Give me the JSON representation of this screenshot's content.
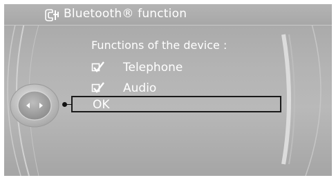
{
  "window": {
    "title": "Bluetooth® function",
    "title_icon": "phone-settings-icon"
  },
  "section": {
    "heading": "Functions of the device :"
  },
  "options": [
    {
      "label": "Telephone",
      "checked": true,
      "icon": "checkbox-checked-icon"
    },
    {
      "label": "Audio",
      "checked": true,
      "icon": "checkbox-checked-icon"
    }
  ],
  "ok_button": {
    "label": "OK",
    "selected": true
  },
  "controller": {
    "icon": "controller-knob-icon",
    "arrows": [
      "left",
      "right"
    ]
  },
  "colors": {
    "screen_bg": "#b2b2b2",
    "text": "#ffffff",
    "focus_border": "#1a1a1a"
  }
}
